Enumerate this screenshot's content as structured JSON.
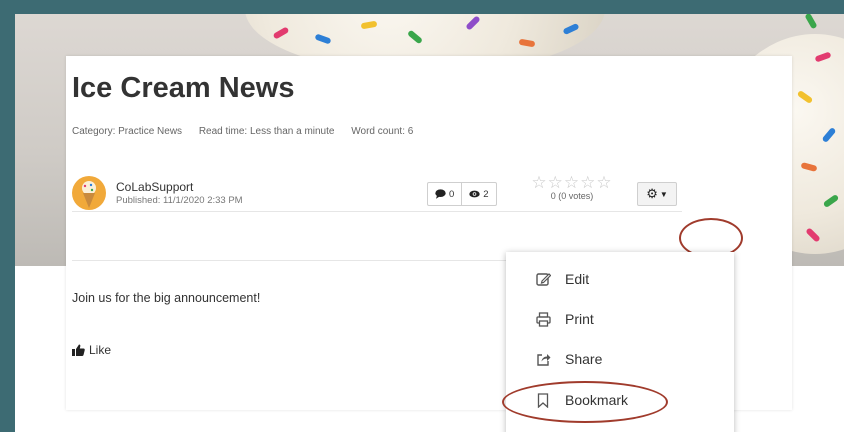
{
  "article": {
    "title": "Ice Cream News",
    "category": "Category: Practice News",
    "read_time": "Read time: Less than a minute",
    "word_count": "Word count: 6",
    "author": "CoLabSupport",
    "published": "Published: 11/1/2020 2:33 PM",
    "comments_count": "0",
    "views_count": "2",
    "rating_text": "0 (0 votes)",
    "body": "Join us for the big announcement!",
    "like_label": "Like"
  },
  "rating": {
    "value": 0,
    "max": 5
  },
  "options_menu": {
    "items": [
      {
        "label": "Edit",
        "icon": "edit-icon"
      },
      {
        "label": "Print",
        "icon": "print-icon"
      },
      {
        "label": "Share",
        "icon": "share-icon"
      },
      {
        "label": "Bookmark",
        "icon": "bookmark-icon"
      }
    ]
  },
  "colors": {
    "frame": "#3d6b73",
    "highlight": "#a03b2c",
    "text": "#333333"
  }
}
